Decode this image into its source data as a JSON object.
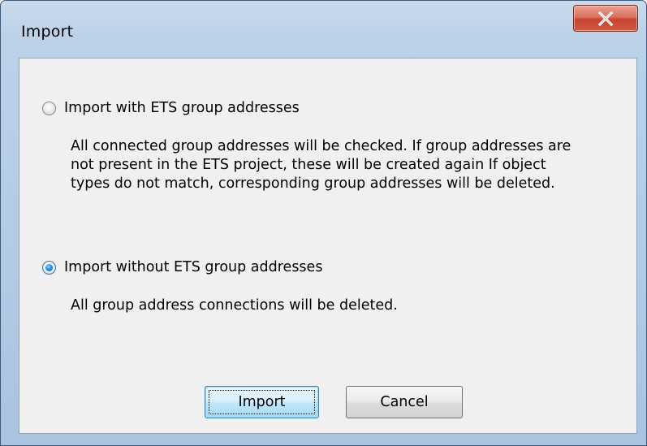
{
  "window": {
    "title": "Import"
  },
  "titlebar": {
    "close_icon": "close-x-icon",
    "close_color": "#c74430"
  },
  "options": [
    {
      "label": "Import with ETS group addresses",
      "checked": false,
      "description_lines": [
        "All connected group addresses will be checked. If group addresses are",
        "not present in the ETS project, these will be created again If object",
        "types do not match, corresponding group addresses will be deleted."
      ]
    },
    {
      "label": "Import without ETS group addresses",
      "checked": true,
      "description_lines": [
        "All group address connections will be deleted."
      ]
    }
  ],
  "buttons": {
    "import_label": "Import",
    "cancel_label": "Cancel"
  },
  "colors": {
    "frame": "#b2cae4",
    "client": "#f0f0f0",
    "radio_selected": "#2f8fe0",
    "default_button": "#bee6fd"
  }
}
